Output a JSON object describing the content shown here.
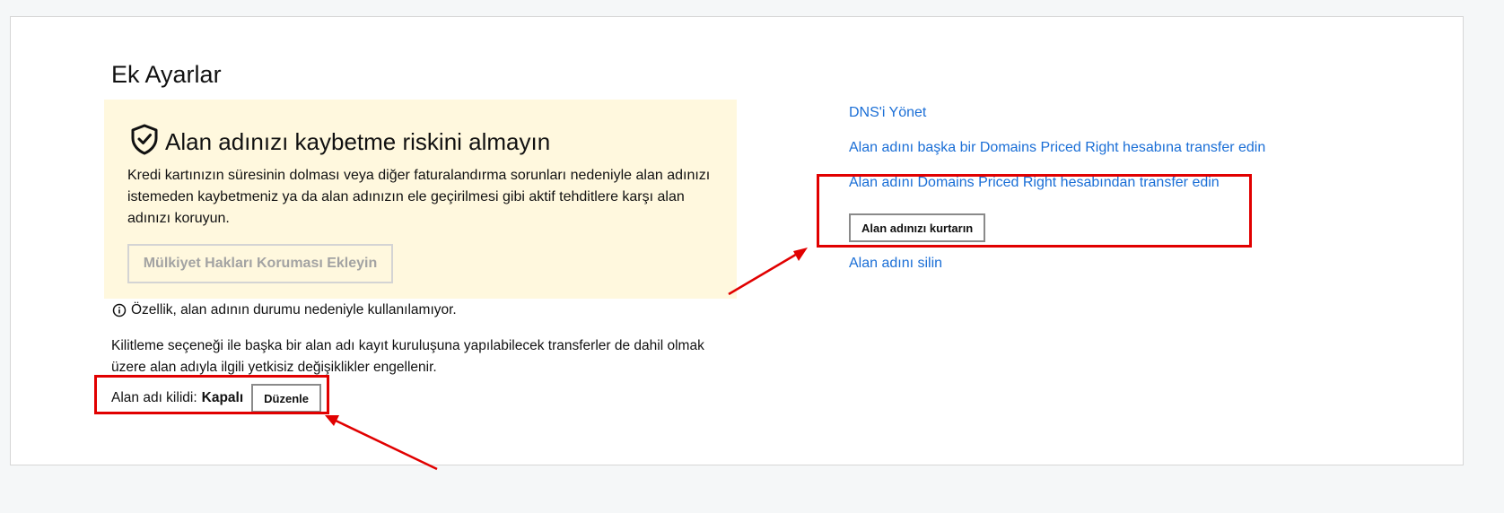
{
  "page": {
    "title": "Ek Ayarlar"
  },
  "promo": {
    "icon": "shield-check-icon",
    "title": "Alan adınızı kaybetme riskini almayın",
    "description": "Kredi kartınızın süresinin dolması veya diğer faturalandırma sorunları nedeniyle alan adınızı istemeden kaybetmeniz ya da alan adınızın ele geçirilmesi gibi aktif tehditlere karşı alan adınızı koruyun.",
    "button_label": "Mülkiyet Hakları Koruması Ekleyin"
  },
  "notice": {
    "icon": "info-circle-icon",
    "text": "Özellik, alan adının durumu nedeniyle kullanılamıyor."
  },
  "lock": {
    "description": "Kilitleme seçeneği ile başka bir alan adı kayıt kuruluşuna yapılabilecek transferler de dahil olmak üzere alan adıyla ilgili yetkisiz değişiklikler engellenir.",
    "label": "Alan adı kilidi:",
    "status": "Kapalı",
    "edit_label": "Düzenle"
  },
  "side_links": {
    "manage_dns": "DNS'i Yönet",
    "transfer_to_account": "Alan adını başka bir Domains Priced Right hesabına transfer edin",
    "transfer_out": "Alan adını Domains Priced Right hesabından transfer edin",
    "recover_button": "Alan adınızı kurtarın",
    "delete": "Alan adını silin"
  },
  "colors": {
    "link": "#1a6ed6",
    "annotation": "#e10000",
    "promo_bg": "#fff8de"
  }
}
